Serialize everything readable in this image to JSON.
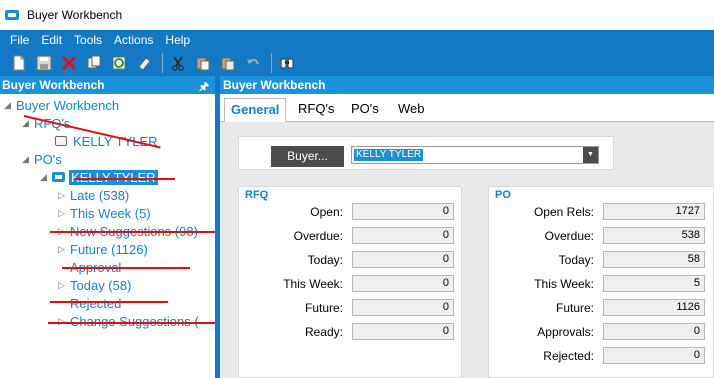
{
  "window": {
    "title": "Buyer Workbench"
  },
  "menu": [
    "File",
    "Edit",
    "Tools",
    "Actions",
    "Help"
  ],
  "toolbar": {
    "icons": [
      "new-icon",
      "save-icon",
      "delete-icon",
      "copy-icon",
      "refresh-icon",
      "clear-icon",
      "cut-icon",
      "paste-icon",
      "paste-special-icon",
      "undo-icon",
      "binoculars-icon"
    ]
  },
  "left_panel": {
    "title": "Buyer Workbench"
  },
  "tree": {
    "root": "Buyer Workbench",
    "rfqs": "RFQ's",
    "rfq_person": "KELLY TYLER",
    "pos": "PO's",
    "po_person": "KELLY TYLER",
    "late": "Late (538)",
    "this_week": "This Week (5)",
    "new_suggestions": "New Suggestions (98)",
    "future": "Future (1126)",
    "approval": "Approval",
    "today": "Today (58)",
    "rejected": "Rejected",
    "change_suggestions": "Change Suggestions ("
  },
  "right_panel": {
    "title": "Buyer Workbench"
  },
  "tabs": [
    "General",
    "RFQ's",
    "PO's",
    "Web"
  ],
  "buyer": {
    "button_label": "Buyer...",
    "selected": "KELLY TYLER"
  },
  "rfq": {
    "title": "RFQ",
    "labels": [
      "Open:",
      "Overdue:",
      "Today:",
      "This Week:",
      "Future:",
      "Ready:"
    ],
    "values": [
      "0",
      "0",
      "0",
      "0",
      "0",
      "0"
    ]
  },
  "po": {
    "title": "PO",
    "labels": [
      "Open Rels:",
      "Overdue:",
      "Today:",
      "This Week:",
      "Future:",
      "Approvals:",
      "Rejected:"
    ],
    "values": [
      "1727",
      "538",
      "58",
      "5",
      "1126",
      "0",
      "0"
    ]
  },
  "colors": {
    "accent": "#1479c4",
    "header": "#1a93db",
    "strike": "#d11111",
    "link": "#1a7fc4"
  }
}
